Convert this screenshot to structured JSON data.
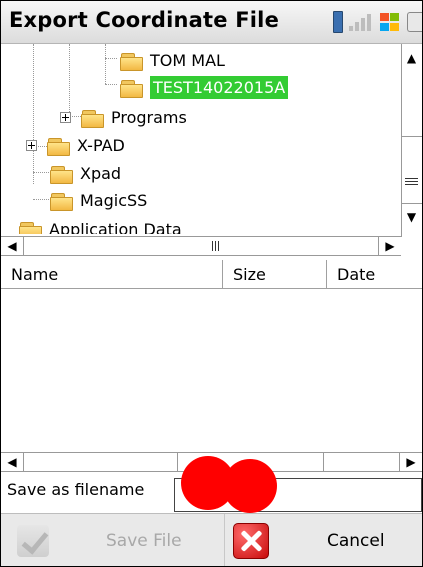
{
  "window": {
    "title": "Export Coordinate File"
  },
  "status_icons": [
    "battery-icon",
    "signal-icon",
    "windows-flag-icon",
    "more-icon"
  ],
  "tree": {
    "items": [
      {
        "label": "TOM MAL",
        "level": 4,
        "selected": false,
        "expandable": false
      },
      {
        "label": "TEST14022015A",
        "level": 4,
        "selected": true,
        "expandable": false
      },
      {
        "label": "Programs",
        "level": 3,
        "selected": false,
        "expandable": true
      },
      {
        "label": "X-PAD",
        "level": 2,
        "selected": false,
        "expandable": true
      },
      {
        "label": "Xpad",
        "level": 2,
        "selected": false,
        "expandable": false
      },
      {
        "label": "MagicSS",
        "level": 2,
        "selected": false,
        "expandable": false
      },
      {
        "label": "Application Data",
        "level": 1,
        "selected": false,
        "expandable": false
      }
    ],
    "selected_color": "#33cc33"
  },
  "list": {
    "columns": [
      "Name",
      "Size",
      "Date"
    ],
    "rows": []
  },
  "filename": {
    "label": "Save as filename",
    "value": ""
  },
  "buttons": {
    "save_label": "Save File",
    "save_enabled": false,
    "cancel_label": "Cancel"
  },
  "colors": {
    "redaction": "#ff0000",
    "cancel_icon": "#d01010"
  }
}
